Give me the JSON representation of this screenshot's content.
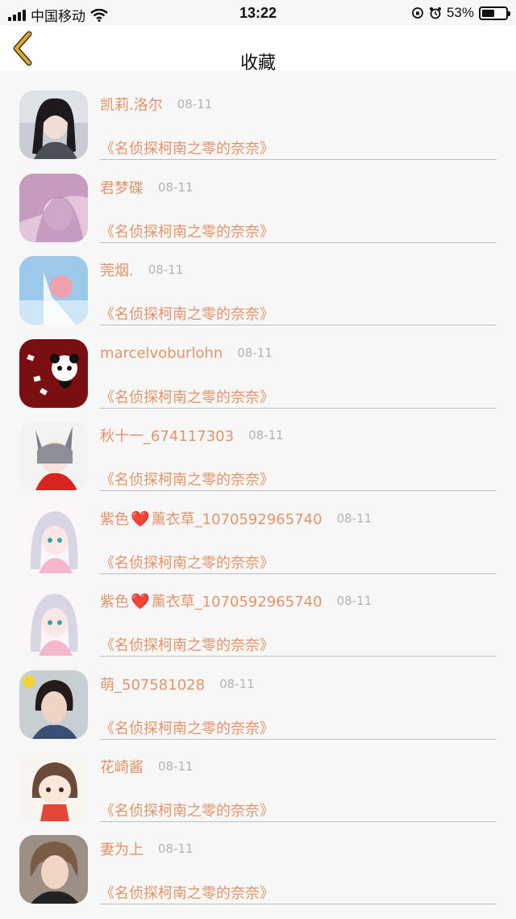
{
  "status_bar": {
    "carrier": "中国移动",
    "time": "13:22",
    "battery_percent": "53%",
    "battery_level": 0.53,
    "icons": [
      "signal-icon",
      "wifi-icon",
      "rotation-lock-icon",
      "alarm-icon",
      "battery-icon"
    ]
  },
  "nav": {
    "title": "收藏",
    "back_icon": "chevron-left-icon",
    "accent": "#e2a23b"
  },
  "colors": {
    "name_text": "#e2946a",
    "date_text": "#b3b3b3",
    "background": "#f7f7f7"
  },
  "items": [
    {
      "name": "凯莉.洛尔",
      "date": "08-11",
      "title": "《名侦探柯南之零的奈奈》",
      "avatar": "avatar-girl-portrait"
    },
    {
      "name": "君梦碟",
      "date": "08-11",
      "title": "《名侦探柯南之零的奈奈》",
      "avatar": "avatar-pink-anime"
    },
    {
      "name": "莞烟.",
      "date": "08-11",
      "title": "《名侦探柯南之零的奈奈》",
      "avatar": "avatar-blue-anime"
    },
    {
      "name": "marcelvoburlohn",
      "date": "08-11",
      "title": "《名侦探柯南之零的奈奈》",
      "avatar": "avatar-panda"
    },
    {
      "name": "秋十一_674117303",
      "date": "08-11",
      "title": "《名侦探柯南之零的奈奈》",
      "avatar": "avatar-cat-girl"
    },
    {
      "name_prefix": "紫色",
      "name_suffix": "薰衣草_1070592965740",
      "date": "08-11",
      "title": "《名侦探柯南之零的奈奈》",
      "avatar": "avatar-silver-anime"
    },
    {
      "name_prefix": "紫色",
      "name_suffix": "薰衣草_1070592965740",
      "date": "08-11",
      "title": "《名侦探柯南之零的奈奈》",
      "avatar": "avatar-silver-anime"
    },
    {
      "name": "萌_507581028",
      "date": "08-11",
      "title": "《名侦探柯南之零的奈奈》",
      "avatar": "avatar-girl-photo"
    },
    {
      "name": "花崎酱",
      "date": "08-11",
      "title": "《名侦探柯南之零的奈奈》",
      "avatar": "avatar-chibi"
    },
    {
      "name": "妻为上",
      "date": "08-11",
      "title": "《名侦探柯南之零的奈奈》",
      "avatar": "avatar-boy-photo"
    }
  ]
}
